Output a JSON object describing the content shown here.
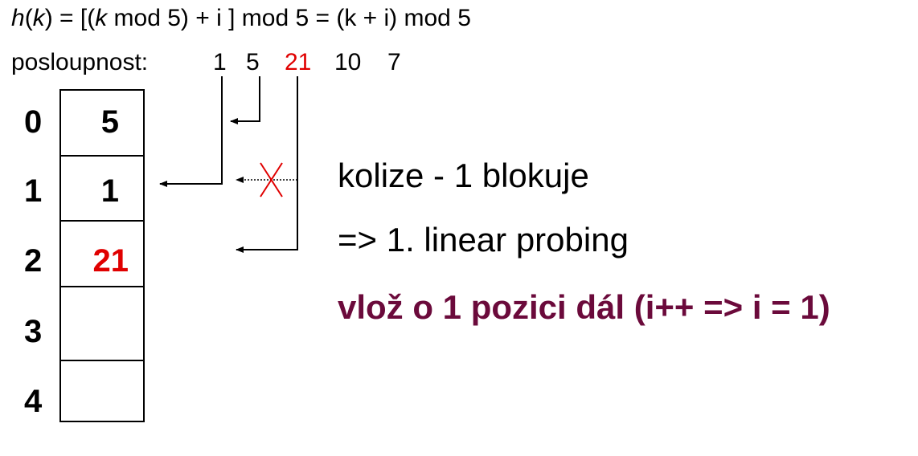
{
  "formula": {
    "h": "h",
    "open": "(",
    "k": "k",
    "close_eq": ") = [(",
    "k2": "k",
    "rest": " mod 5) + i ] mod 5 = (k + i) mod 5"
  },
  "sequence": {
    "label": "posloupnost:",
    "items": [
      {
        "text": "1"
      },
      {
        "text": "5"
      },
      {
        "text": "21",
        "highlight": true
      },
      {
        "text": "10"
      },
      {
        "text": "7"
      }
    ]
  },
  "table": {
    "indices": [
      "0",
      "1",
      "2",
      "3",
      "4"
    ],
    "values": [
      "5",
      "1",
      "21",
      "",
      ""
    ],
    "highlight_row": 2
  },
  "notes": {
    "line1": "kolize - 1 blokuje",
    "line2": "=> 1. linear probing",
    "line3": "vlož o 1 pozici dál (i++ => i = 1)"
  },
  "colors": {
    "highlight": "#e00000",
    "emphasis": "#6b0a3b"
  }
}
